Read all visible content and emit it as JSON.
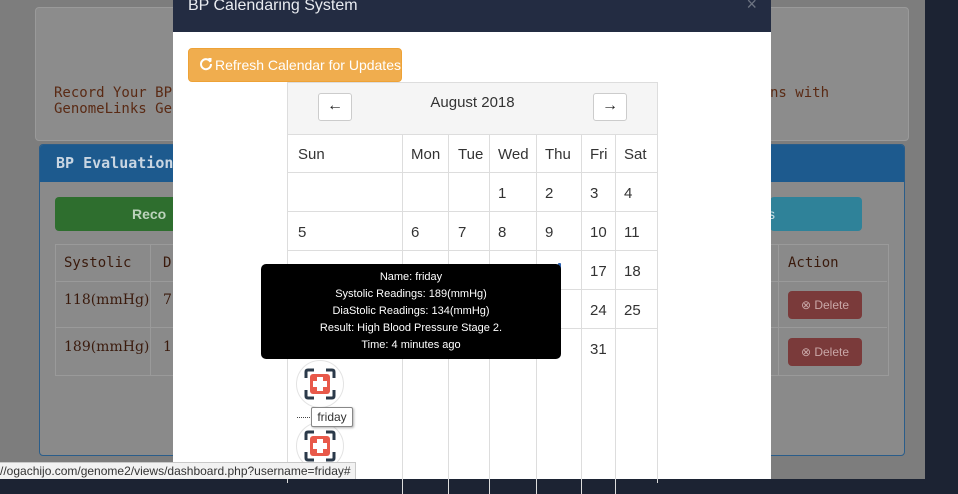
{
  "background": {
    "intro_left_line1": "Record Your BP Le",
    "intro_left_line2": "GenomeLinks Gene",
    "intro_right": "ns with",
    "panel_title": "BP Evaluation Sy",
    "record_button": "Reco",
    "teal_button": "s",
    "table": {
      "headers": [
        "Systolic",
        "D",
        "Action"
      ],
      "rows": [
        {
          "systolic": "118(mmHg)",
          "d": "7",
          "action": "Delete"
        },
        {
          "systolic": "189(mmHg)",
          "d": "1",
          "action": "Delete"
        }
      ]
    }
  },
  "modal": {
    "title": "BP Calendaring System",
    "close": "×",
    "refresh_button": "Refresh Calendar for Updates"
  },
  "calendar": {
    "month": "August 2018",
    "prev": "←",
    "next": "→",
    "weekdays": [
      "Sun",
      "Mon",
      "Tue",
      "Wed",
      "Thu",
      "Fri",
      "Sat"
    ],
    "week1": [
      "",
      "",
      "",
      "1",
      "2",
      "3",
      "4"
    ],
    "week2": [
      "5",
      "6",
      "7",
      "8",
      "9",
      "10",
      "11"
    ],
    "week3_visible": {
      "fri": "17",
      "sat": "18"
    },
    "week4_visible": {
      "fri": "24",
      "sat": "25"
    },
    "week5_visible": {
      "fri": "31"
    }
  },
  "tooltip": {
    "name": "Name: friday",
    "systolic": "Systolic Readings: 189(mmHg)",
    "diastolic": "DiaStolic Readings: 134(mmHg)",
    "result": "Result: High Blood Pressure Stage 2.",
    "time": "Time: 4 minutes ago"
  },
  "event_label": "friday",
  "status_url": "//ogachijo.com/genome2/views/dashboard.php?username=friday#",
  "colors": {
    "modal_header": "#232c42",
    "refresh_button": "#f0ad4e",
    "event_icon_red": "#e8594a",
    "event_icon_dark": "#2b3a4a"
  }
}
